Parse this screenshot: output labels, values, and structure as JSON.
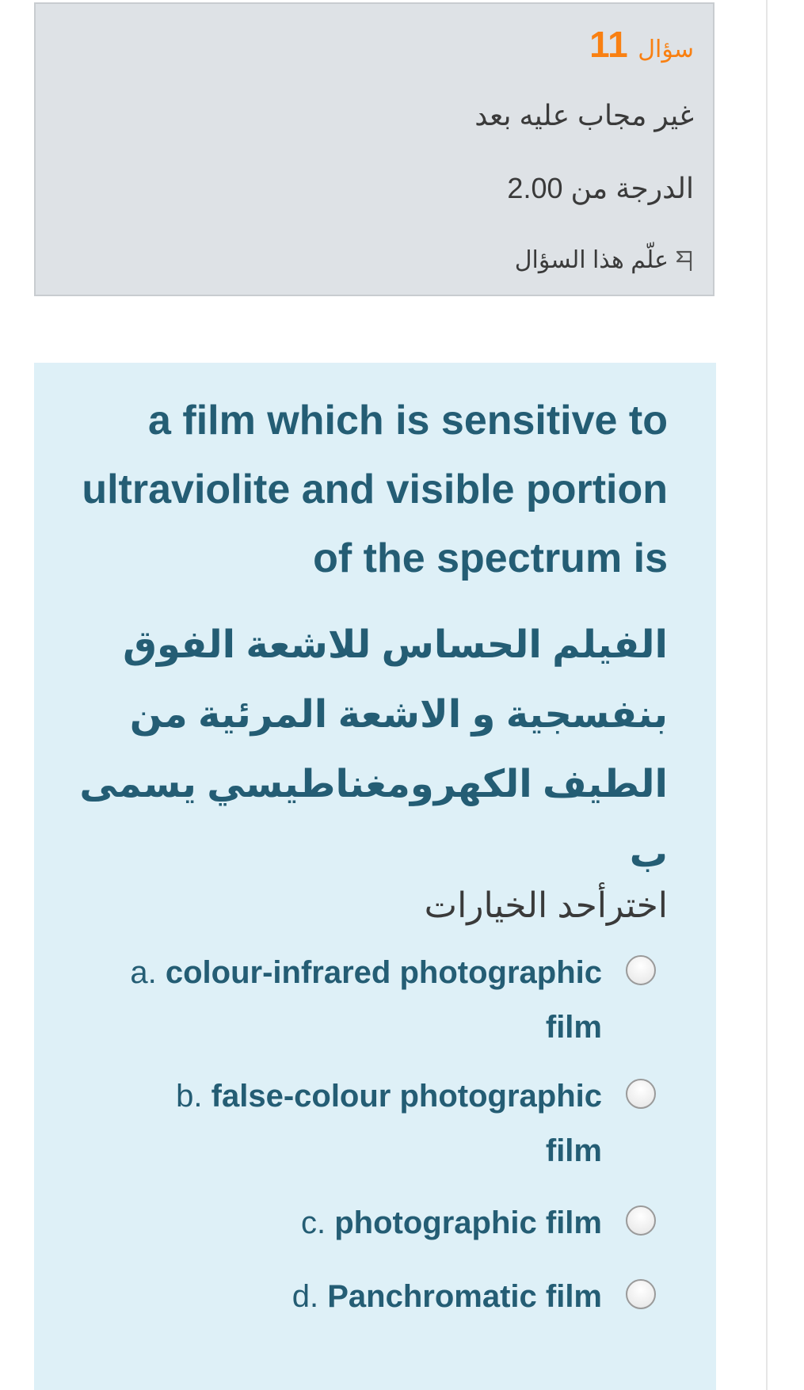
{
  "info": {
    "question_label": "سؤال",
    "question_number": "11",
    "state": "غير مجاب عليه بعد",
    "grade": "الدرجة من 2.00",
    "flag_label": "علّم هذا السؤال",
    "flag_icon": "flag-icon",
    "accent_color": "#f98012"
  },
  "question": {
    "text_en": "a film which is sensitive to ultraviolite and visible portion of the spectrum is",
    "text_ar": "الفيلم الحساس للاشعة الفوق بنفسجية و الاشعة المرئية من الطيف الكهرومغناطيسي يسمى ب",
    "prompt": "اخترأحد الخيارات",
    "text_color": "#245d74",
    "background_color": "#def0f7"
  },
  "options": [
    {
      "letter": "a.",
      "label": "colour-infrared photographic film",
      "selected": false
    },
    {
      "letter": "b.",
      "label": "false-colour photographic film",
      "selected": false
    },
    {
      "letter": "c.",
      "label": "photographic film",
      "selected": false
    },
    {
      "letter": "d.",
      "label": "Panchromatic film",
      "selected": false
    }
  ]
}
